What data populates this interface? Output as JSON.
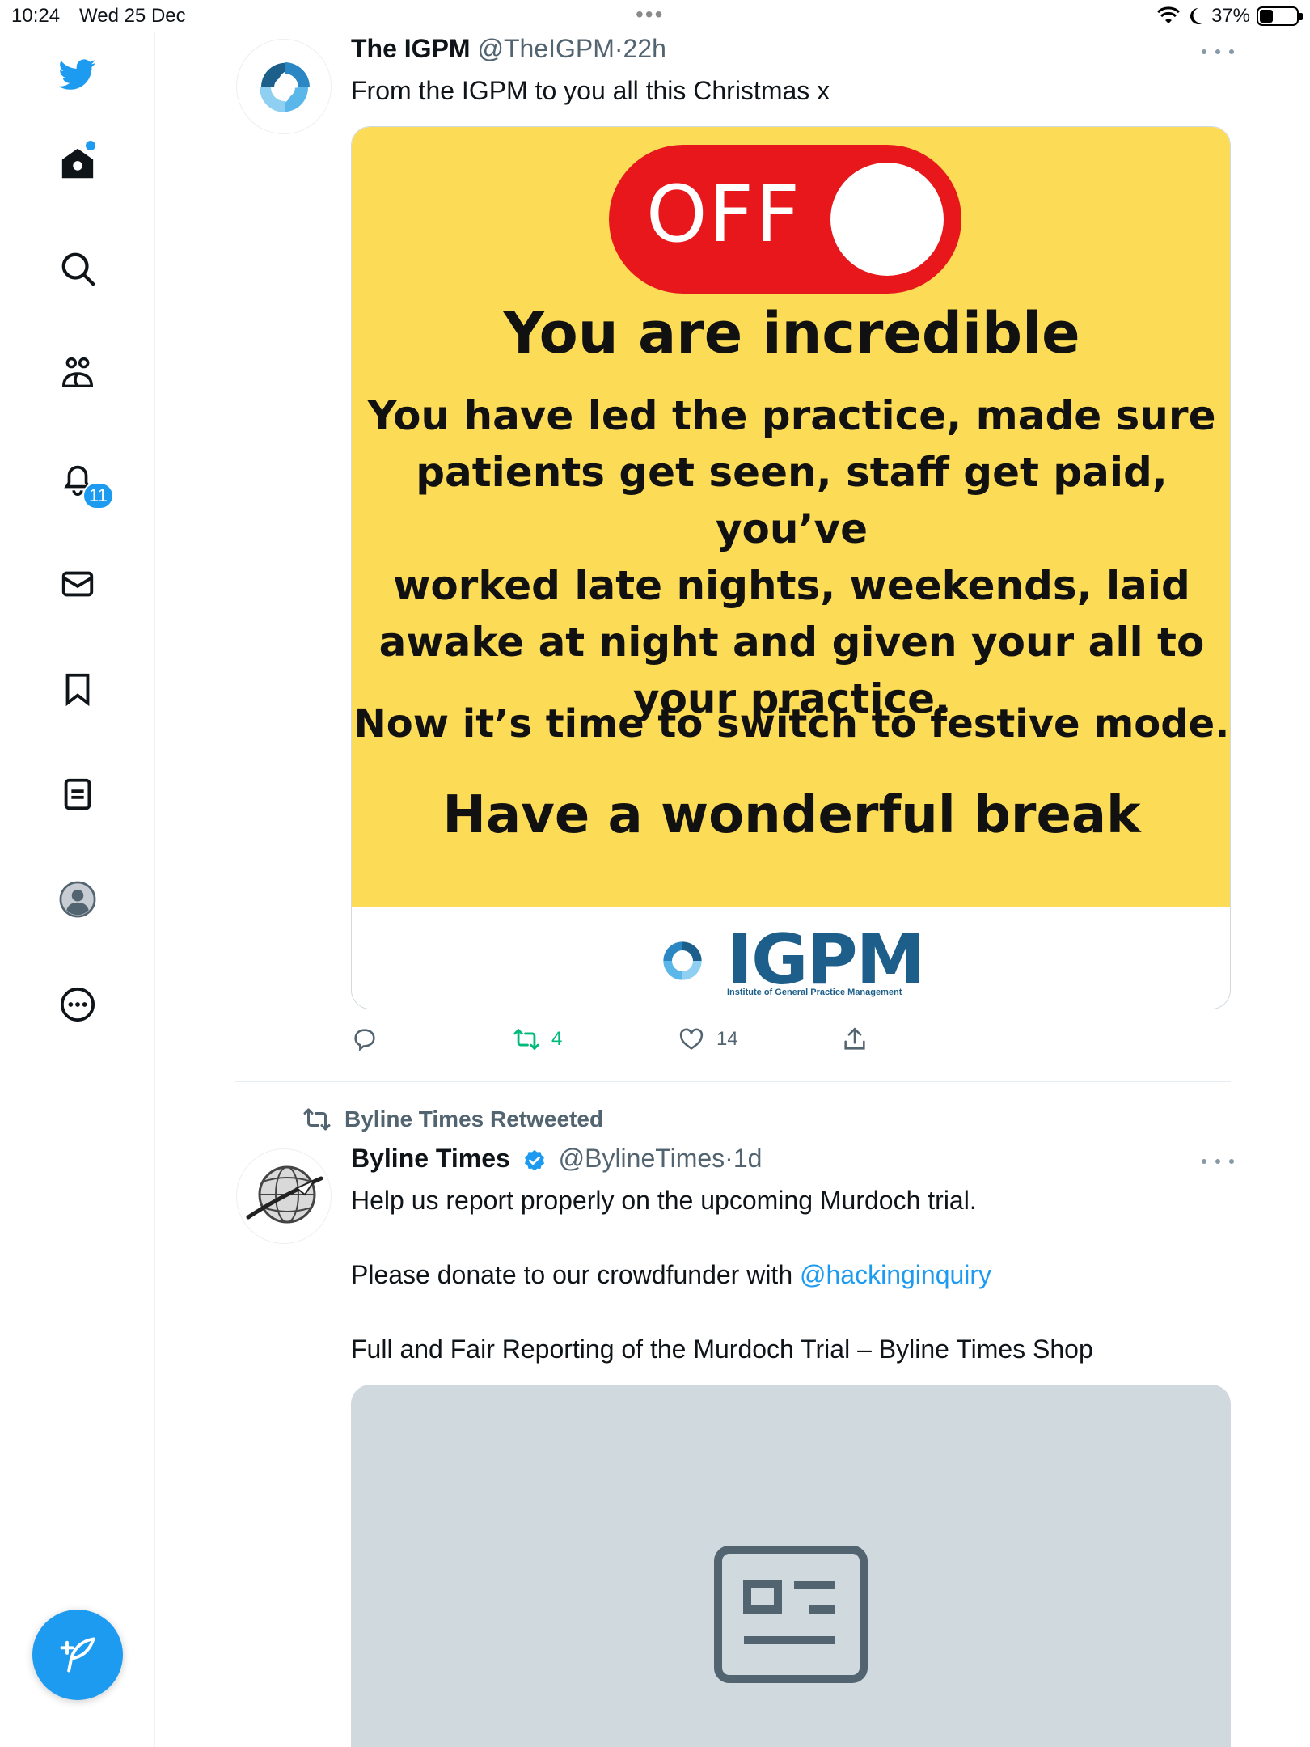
{
  "status_bar": {
    "time": "10:24",
    "date": "Wed 25 Dec",
    "battery_percent": "37%",
    "battery_level": 0.37
  },
  "sidebar": {
    "items": [
      {
        "icon": "twitter-bird-icon"
      },
      {
        "icon": "home-icon",
        "has_dot": true
      },
      {
        "icon": "search-icon"
      },
      {
        "icon": "communities-icon"
      },
      {
        "icon": "notifications-bell-icon",
        "badge": "11"
      },
      {
        "icon": "messages-envelope-icon"
      },
      {
        "icon": "bookmarks-icon"
      },
      {
        "icon": "lists-icon"
      },
      {
        "icon": "profile-avatar-icon"
      },
      {
        "icon": "more-circle-icon"
      }
    ],
    "compose_icon": "compose-tweet-icon"
  },
  "colors": {
    "accent": "#1d9bf0",
    "retweet_active": "#00ba7c",
    "poster_background": "#fcdc57",
    "toggle_red": "#e8171b",
    "link_card_placeholder": "#cfd9de"
  },
  "tweets": [
    {
      "name": "The IGPM",
      "handle": "@TheIGPM",
      "separator": "·",
      "time": "22h",
      "text": "From the IGPM to you all this Christmas x",
      "image": {
        "toggle_label": "OFF",
        "heading": "You are incredible",
        "body_lines": [
          "You have led the practice, made sure",
          "patients get seen, staff get paid, you’ve",
          "worked late nights, weekends, laid",
          "awake at night and given your all to",
          "your practice."
        ],
        "line2": "Now it’s time to switch to festive mode.",
        "closing": "Have a wonderful break",
        "logo_text": "IGPM",
        "logo_subtitle": "Institute of General Practice Management"
      },
      "actions": {
        "reply_count": "",
        "retweet_count": "4",
        "like_count": "14"
      }
    },
    {
      "retweeted_by": "Byline Times Retweeted",
      "name": "Byline Times",
      "verified": true,
      "handle": "@BylineTimes",
      "separator": "·",
      "time": "1d",
      "text_line1": "Help us report properly on the upcoming Murdoch trial.",
      "text_line2_prefix": "Please donate to our crowdfunder with ",
      "text_line2_mention": "@hackinginquiry",
      "text_line3": "Full and Fair Reporting of the Murdoch Trial – Byline Times Shop",
      "link_card_icon": "article-placeholder-icon"
    }
  ]
}
